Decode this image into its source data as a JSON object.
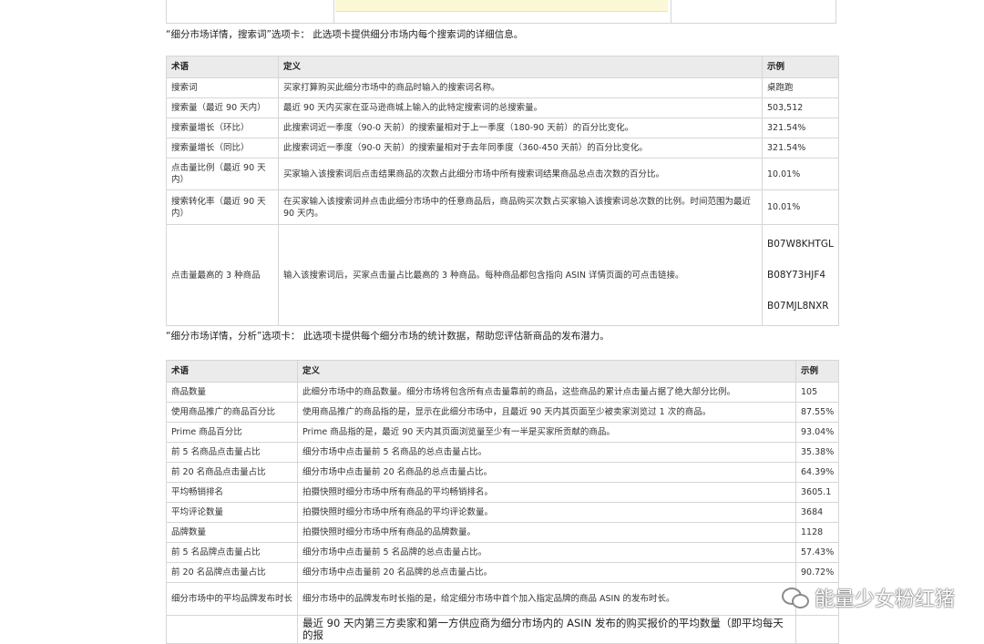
{
  "section1": {
    "intro": "“细分市场详情，搜索词”选项卡： 此选项卡提供细分市场内每个搜索词的详细信息。",
    "headers": [
      "术语",
      "定义",
      "示例"
    ],
    "rows": [
      {
        "term": "搜索词",
        "def": "买家打算购买此细分市场中的商品时输入的搜索词名称。",
        "example": "桌跑跑"
      },
      {
        "term": "搜索量（最近 90 天内）",
        "def": "最近 90 天内买家在亚马逊商城上输入的此特定搜索词的总搜索量。",
        "example": "503,512"
      },
      {
        "term": "搜索量增长（环比）",
        "def": "此搜索词近一季度（90-0 天前）的搜索量相对于上一季度（180-90 天前）的百分比变化。",
        "example": "321.54%"
      },
      {
        "term": "搜索量增长（同比）",
        "def": "此搜索词近一季度（90-0 天前）的搜索量相对于去年同季度（360-450 天前）的百分比变化。",
        "example": "321.54%"
      },
      {
        "term": "点击量比例（最近 90 天内）",
        "def": "买家输入该搜索词后点击结果商品的次数占此细分市场中所有搜索词结果商品总点击次数的百分比。",
        "example": "10.01%"
      },
      {
        "term": "搜索转化率（最近 90 天内）",
        "def": "在买家输入该搜索词并点击此细分市场中的任意商品后，商品购买次数占买家输入该搜索词总次数的比例。时间范围为最近 90 天内。",
        "example": "10.01%"
      },
      {
        "term": "点击量最高的 3 种商品",
        "def": "输入该搜索词后，买家点击量占比最高的 3 种商品。每种商品都包含指向 ASIN 详情页面的可点击链接。",
        "asins": [
          "B07W8KHTGL",
          "B08Y73HJF4",
          "B07MJL8NXR"
        ]
      }
    ]
  },
  "section2": {
    "intro": "“细分市场详情，分析”选项卡： 此选项卡提供每个细分市场的统计数据，帮助您评估新商品的发布潜力。",
    "headers": [
      "术语",
      "定义",
      "示例"
    ],
    "rows": [
      {
        "term": "商品数量",
        "def": "此细分市场中的商品数量。细分市场将包含所有点击量靠前的商品，这些商品的累计点击量占据了绝大部分比例。",
        "example": "105"
      },
      {
        "term": "使用商品推广的商品百分比",
        "def": "使用商品推广的商品指的是，显示在此细分市场中，且最近 90 天内其页面至少被卖家浏览过 1 次的商品。",
        "example": "87.55%"
      },
      {
        "term": "Prime 商品百分比",
        "def": "Prime 商品指的是，最近 90 天内其页面浏览量至少有一半是买家所贡献的商品。",
        "example": "93.04%"
      },
      {
        "term": "前 5 名商品点击量占比",
        "def": "细分市场中点击量前 5 名商品的总点击量占比。",
        "example": "35.38%"
      },
      {
        "term": "前 20 名商品点击量占比",
        "def": "细分市场中点击量前 20 名商品的总点击量占比。",
        "example": "64.39%"
      },
      {
        "term": "平均畅销排名",
        "def": "拍摄快照时细分市场中所有商品的平均畅销排名。",
        "example": "3605.1"
      },
      {
        "term": "平均评论数量",
        "def": "拍摄快照时细分市场中所有商品的平均评论数量。",
        "example": "3684"
      },
      {
        "term": "品牌数量",
        "def": "拍摄快照时细分市场中所有商品的品牌数量。",
        "example": "1128"
      },
      {
        "term": "前 5 名品牌点击量占比",
        "def": "细分市场中点击量前 5 名品牌的总点击量占比。",
        "example": "57.43%"
      },
      {
        "term": "前 20 名品牌点击量占比",
        "def": "细分市场中点击量前 20 名品牌的总点击量占比。",
        "example": "90.72%"
      },
      {
        "term": "细分市场中的平均品牌发布时长",
        "def": "细分市场中的品牌发布时长指的是，给定细分市场中首个加入指定品牌的商品 ASIN 的发布时长。",
        "example": ""
      },
      {
        "term": "",
        "def": "最近 90 天内第三方卖家和第一方供应商为细分市场内的 ASIN 发布的购买报价的平均数量（即平均每天的报",
        "example": ""
      }
    ]
  },
  "watermark": {
    "text": "能量少女粉红猪",
    "icon": "wechat-icon"
  }
}
